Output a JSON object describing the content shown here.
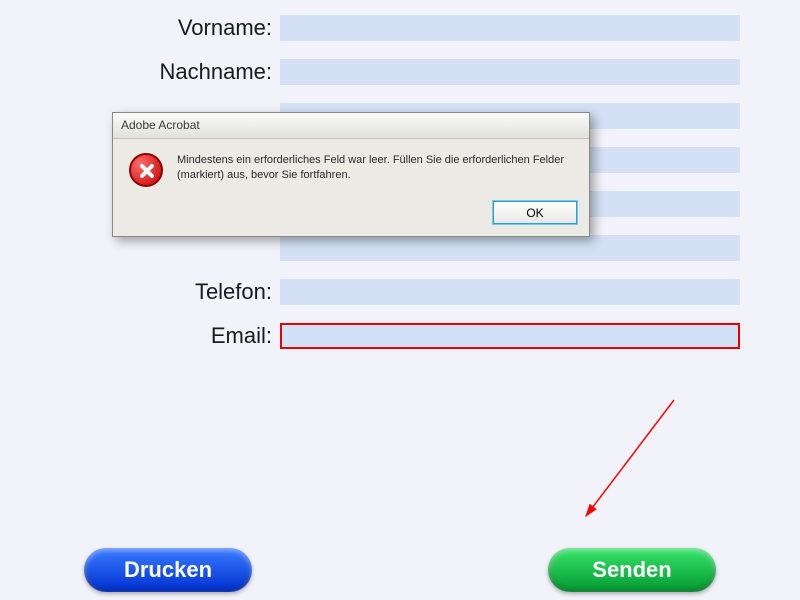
{
  "form": {
    "rows": [
      {
        "label": "Vorname:",
        "required": false
      },
      {
        "label": "Nachname:",
        "required": false
      },
      {
        "label": "",
        "required": false
      },
      {
        "label": "",
        "required": false
      },
      {
        "label": "",
        "required": false
      },
      {
        "label": "",
        "required": false
      },
      {
        "label": "Telefon:",
        "required": false
      },
      {
        "label": "Email:",
        "required": true
      }
    ]
  },
  "buttons": {
    "print": "Drucken",
    "send": "Senden"
  },
  "dialog": {
    "title": "Adobe Acrobat",
    "message": "Mindestens ein erforderliches Feld war leer. Füllen Sie die erforderlichen Felder (markiert) aus, bevor Sie fortfahren.",
    "ok": "OK"
  }
}
